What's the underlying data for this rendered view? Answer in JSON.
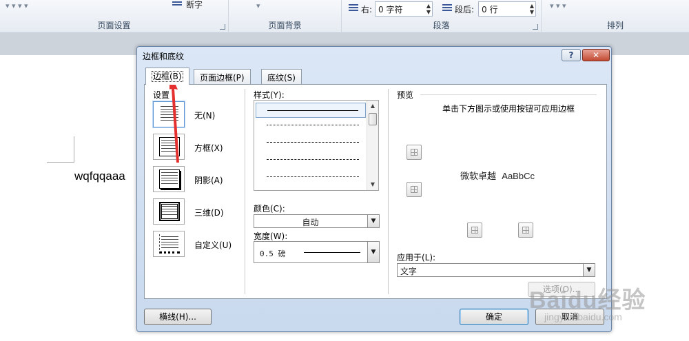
{
  "ribbon": {
    "groups": [
      {
        "label": "页面设置"
      },
      {
        "label": "页面背景"
      },
      {
        "label": "段落"
      },
      {
        "label": "排列"
      }
    ],
    "hyphenation_label": "断字",
    "indent_right_label": "右:",
    "indent_right_value": "0 字符",
    "space_after_label": "段后:",
    "space_after_value": "0 行"
  },
  "document": {
    "text": "wqfqqaaa"
  },
  "dialog": {
    "title": "边框和底纹",
    "help_label": "?",
    "close_label": "✕",
    "tabs": [
      {
        "label": "边框(B)",
        "active": true
      },
      {
        "label": "页面边框(P)",
        "active": false
      },
      {
        "label": "底纹(S)",
        "active": false
      }
    ],
    "settings": {
      "label": "设置",
      "items": [
        {
          "label": "无(N)",
          "selected": true
        },
        {
          "label": "方框(X)",
          "selected": false
        },
        {
          "label": "阴影(A)",
          "selected": false
        },
        {
          "label": "三维(D)",
          "selected": false
        },
        {
          "label": "自定义(U)",
          "selected": false
        }
      ]
    },
    "style": {
      "label": "样式(Y):",
      "line_options": [
        "solid",
        "dotted",
        "dashed-fine",
        "dashed",
        "dash-dot"
      ]
    },
    "color": {
      "label": "颜色(C):",
      "value": "自动"
    },
    "width": {
      "label": "宽度(W):",
      "value": "0.5 磅"
    },
    "preview": {
      "label": "预览",
      "hint": "单击下方图示或使用按钮可应用边框",
      "sample_cn": "微软卓越",
      "sample_en": "AaBbCc"
    },
    "apply_to": {
      "label": "应用于(L):",
      "value": "文字"
    },
    "options_button": "选项(O)...",
    "horizontal_line_button": "横线(H)...",
    "ok_button": "确定",
    "cancel_button": "取消"
  },
  "watermark": {
    "brand": "Baidu经验",
    "url": "jingyan.baidu.com"
  },
  "colors": {
    "dialog_bg": "#d3e1f3",
    "annotation_arrow": "#e53030",
    "selected_border": "#5c94d4"
  }
}
